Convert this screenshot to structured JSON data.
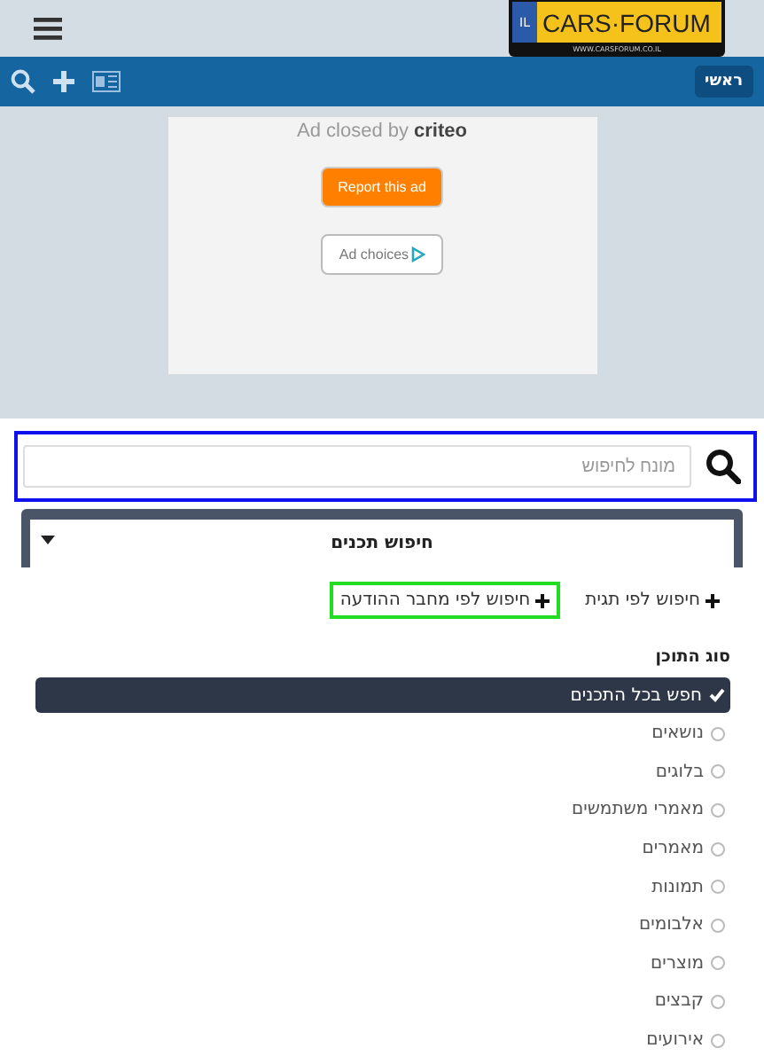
{
  "header": {
    "logo": {
      "plate_code": "IL",
      "name": "CARS·FORUM",
      "url": "WWW.CARSFORUM.CO.IL"
    }
  },
  "navbar": {
    "breadcrumb": "ראשי"
  },
  "ad": {
    "closed_text": "Ad closed by",
    "brand": "criteo",
    "report_button": "Report this ad",
    "choices_button": "Ad choices"
  },
  "search": {
    "placeholder": "מונח לחיפוש"
  },
  "panel": {
    "title": "חיפוש תכנים",
    "expanded": true,
    "links": [
      {
        "label": "חיפוש לפי תגית",
        "highlighted": false
      },
      {
        "label": "חיפוש לפי מחבר ההודעה",
        "highlighted": true
      }
    ],
    "section_title": "סוג התוכן",
    "options": [
      {
        "label": "חפש בכל התכנים",
        "selected": true
      },
      {
        "label": "נושאים",
        "selected": false
      },
      {
        "label": "בלוגים",
        "selected": false
      },
      {
        "label": "מאמרי משתמשים",
        "selected": false
      },
      {
        "label": "מאמרים",
        "selected": false
      },
      {
        "label": "תמונות",
        "selected": false
      },
      {
        "label": "אלבומים",
        "selected": false
      },
      {
        "label": "מוצרים",
        "selected": false
      },
      {
        "label": "קבצים",
        "selected": false
      },
      {
        "label": "אירועים",
        "selected": false
      }
    ]
  }
}
